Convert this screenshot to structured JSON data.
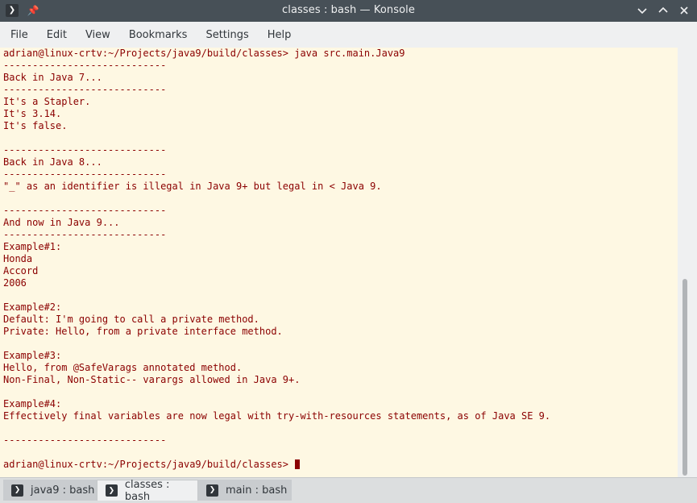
{
  "window": {
    "title": "classes : bash — Konsole",
    "app_icon": "terminal-prompt-icon",
    "controls": [
      "minimize-icon",
      "maximize-icon",
      "close-icon"
    ]
  },
  "menu": {
    "items": [
      "File",
      "Edit",
      "View",
      "Bookmarks",
      "Settings",
      "Help"
    ]
  },
  "terminal": {
    "foreground": "#8b0000",
    "background": "#fef8e3",
    "lines": [
      "adrian@linux-crtv:~/Projects/java9/build/classes> java src.main.Java9",
      "----------------------------",
      "Back in Java 7...",
      "----------------------------",
      "It's a Stapler.",
      "It's 3.14.",
      "It's false.",
      "",
      "----------------------------",
      "Back in Java 8...",
      "----------------------------",
      "\"_\" as an identifier is illegal in Java 9+ but legal in < Java 9.",
      "",
      "----------------------------",
      "And now in Java 9...",
      "----------------------------",
      "Example#1:",
      "Honda",
      "Accord",
      "2006",
      "",
      "Example#2:",
      "Default: I'm going to call a private method.",
      "Private: Hello, from a private interface method.",
      "",
      "Example#3:",
      "Hello, from @SafeVarags annotated method.",
      "Non-Final, Non-Static-- varargs allowed in Java 9+.",
      "",
      "Example#4:",
      "Effectively final variables are now legal with try-with-resources statements, as of Java SE 9.",
      "",
      "----------------------------",
      ""
    ],
    "prompt": "adrian@linux-crtv:~/Projects/java9/build/classes> "
  },
  "tabs": [
    {
      "label": "java9 : bash",
      "active": false
    },
    {
      "label": "classes : bash",
      "active": true
    },
    {
      "label": "main : bash",
      "active": false
    }
  ]
}
